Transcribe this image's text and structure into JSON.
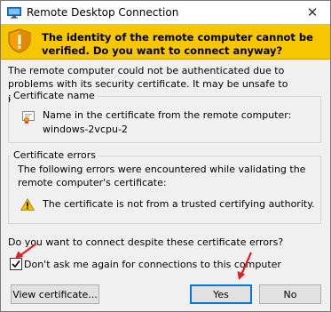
{
  "window": {
    "title": "Remote Desktop Connection",
    "close_glyph": "✕"
  },
  "banner": {
    "headline": "The identity of the remote computer cannot be verified. Do you want to connect anyway?"
  },
  "intro": "The remote computer could not be authenticated due to problems with its security certificate. It may be unsafe to proceed.",
  "certificate_name": {
    "label": "Certificate name",
    "description": "Name in the certificate from the remote computer:",
    "value": "windows-2vcpu-2"
  },
  "certificate_errors": {
    "label": "Certificate errors",
    "description": "The following errors were encountered while validating the remote computer's certificate:",
    "error": "The certificate is not from a trusted certifying authority."
  },
  "question": "Do you want to connect despite these certificate errors?",
  "dont_ask": {
    "label": "Don't ask me again for connections to this computer",
    "checked": true
  },
  "buttons": {
    "view_certificate": "View certificate...",
    "yes": "Yes",
    "no": "No"
  },
  "colors": {
    "banner": "#f6c600",
    "annotation_arrow": "#e02020",
    "default_button_border": "#0078d7"
  }
}
